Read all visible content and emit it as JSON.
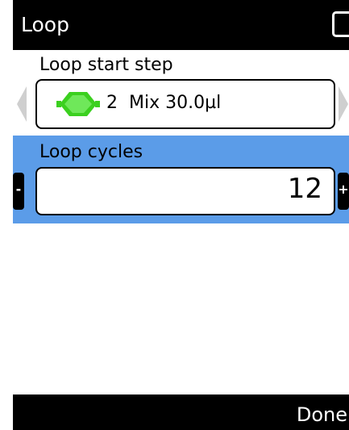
{
  "header": {
    "title": "Loop"
  },
  "loop_start": {
    "label": "Loop start step",
    "step_number": "2",
    "step_text": "Mix 30.0µl",
    "icon": "green-hexagon-icon"
  },
  "loop_cycles": {
    "label": "Loop cycles",
    "value": "12",
    "decrement_label": "-",
    "increment_label": "+"
  },
  "footer": {
    "done_label": "Done"
  },
  "colors": {
    "selection": "#5b9ce8",
    "icon_green": "#3bd01f",
    "bars": "#000000"
  }
}
